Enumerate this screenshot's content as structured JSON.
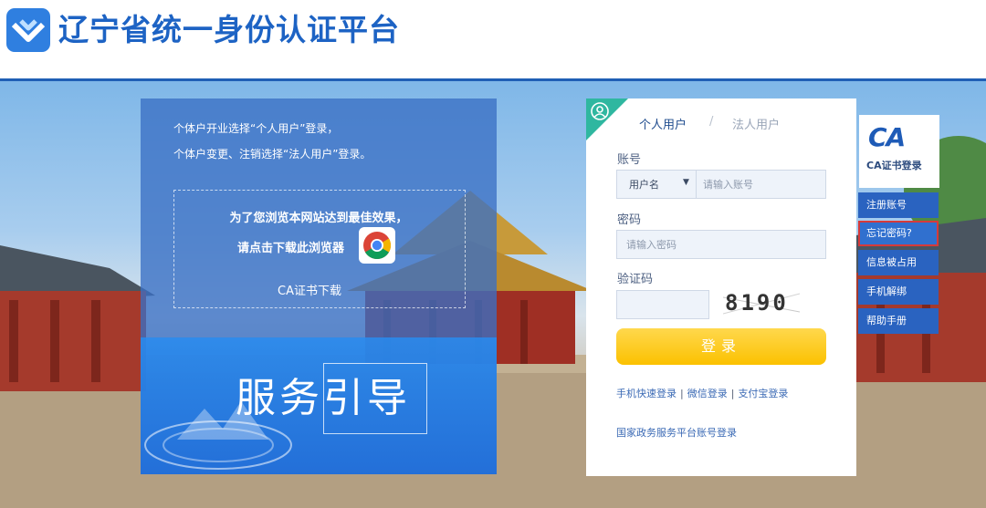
{
  "header": {
    "site_title": "辽宁省统一身份认证平台"
  },
  "guide": {
    "line1": "个体户开业选择“个人用户”登录，",
    "line2": "个体户变更、注销选择“法人用户”登录。",
    "browser_line1": "为了您浏览本网站达到最佳效果，",
    "browser_line2": "请点击下载此浏览器",
    "ca_download": "CA证书下载",
    "service_title": "服务引导"
  },
  "login": {
    "tabs": [
      {
        "label": "个人用户",
        "active": true
      },
      {
        "label": "法人用户",
        "active": false
      }
    ],
    "tab_separator": "/",
    "account_label": "账号",
    "user_type_value": "用户名",
    "account_placeholder": "请输入账号",
    "password_label": "密码",
    "password_placeholder": "请输入密码",
    "captcha_label": "验证码",
    "captcha_code": "8190",
    "submit_label": "登录",
    "quick_links": [
      "手机快速登录",
      "微信登录",
      "支付宝登录"
    ],
    "national_link": "国家政务服务平台账号登录"
  },
  "side": {
    "ca_logo": "CA",
    "ca_label": "CA证书登录",
    "menu": [
      {
        "label": "注册账号",
        "active": false
      },
      {
        "label": "忘记密码?",
        "active": true
      },
      {
        "label": "信息被占用",
        "active": false
      },
      {
        "label": "手机解绑",
        "active": false
      },
      {
        "label": "帮助手册",
        "active": false
      }
    ]
  },
  "colors": {
    "brand_blue": "#1d63c4",
    "login_button": "#fbc100",
    "corner_teal": "#2fb7a0",
    "side_menu": "#2a63c0"
  }
}
